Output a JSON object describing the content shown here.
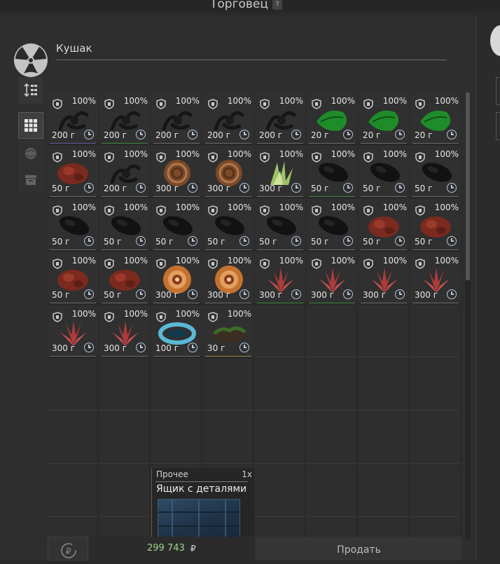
{
  "header": {
    "title": "Торговец",
    "help_label": "?"
  },
  "trader": {
    "name": "Кушак",
    "logo_icon": "radiation-icon"
  },
  "side_buttons": [
    {
      "icon": "sort-icon",
      "active": false
    },
    {
      "icon": "grid-view-icon",
      "active": true
    },
    {
      "icon": "artifact-filter-icon",
      "active": false
    },
    {
      "icon": "box-filter-icon",
      "active": false
    }
  ],
  "inventory": {
    "items": [
      {
        "pct": "100%",
        "weight": "200 г",
        "kind": "black-twig",
        "accent": "purple"
      },
      {
        "pct": "100%",
        "weight": "200 г",
        "kind": "black-twig",
        "accent": "green"
      },
      {
        "pct": "100%",
        "weight": "200 г",
        "kind": "black-twig",
        "accent": "none"
      },
      {
        "pct": "100%",
        "weight": "200 г",
        "kind": "black-twig",
        "accent": "none"
      },
      {
        "pct": "100%",
        "weight": "200 г",
        "kind": "black-twig",
        "accent": "none"
      },
      {
        "pct": "100%",
        "weight": "20 г",
        "kind": "green-leaf",
        "accent": "none"
      },
      {
        "pct": "100%",
        "weight": "20 г",
        "kind": "green-leaf",
        "accent": "none"
      },
      {
        "pct": "100%",
        "weight": "20 г",
        "kind": "green-leaf",
        "accent": "none"
      },
      {
        "pct": "100%",
        "weight": "50 г",
        "kind": "red-lump",
        "accent": "none"
      },
      {
        "pct": "100%",
        "weight": "200 г",
        "kind": "black-twig",
        "accent": "none"
      },
      {
        "pct": "100%",
        "weight": "300 г",
        "kind": "brown-coil",
        "accent": "none"
      },
      {
        "pct": "100%",
        "weight": "300 г",
        "kind": "brown-coil",
        "accent": "none"
      },
      {
        "pct": "100%",
        "weight": "300 г",
        "kind": "green-sprout",
        "accent": "none"
      },
      {
        "pct": "100%",
        "weight": "50 г",
        "kind": "black-pod",
        "accent": "green"
      },
      {
        "pct": "100%",
        "weight": "50 г",
        "kind": "black-pod",
        "accent": "none"
      },
      {
        "pct": "100%",
        "weight": "50 г",
        "kind": "black-pod",
        "accent": "none"
      },
      {
        "pct": "100%",
        "weight": "50 г",
        "kind": "black-pod",
        "accent": "none"
      },
      {
        "pct": "100%",
        "weight": "50 г",
        "kind": "black-pod",
        "accent": "none"
      },
      {
        "pct": "100%",
        "weight": "50 г",
        "kind": "black-pod",
        "accent": "none"
      },
      {
        "pct": "100%",
        "weight": "50 г",
        "kind": "black-pod",
        "accent": "none"
      },
      {
        "pct": "100%",
        "weight": "50 г",
        "kind": "black-pod",
        "accent": "none"
      },
      {
        "pct": "100%",
        "weight": "50 г",
        "kind": "black-pod",
        "accent": "none"
      },
      {
        "pct": "100%",
        "weight": "50 г",
        "kind": "red-lump",
        "accent": "none"
      },
      {
        "pct": "100%",
        "weight": "50 г",
        "kind": "red-lump",
        "accent": "none"
      },
      {
        "pct": "100%",
        "weight": "50 г",
        "kind": "red-lump",
        "accent": "none"
      },
      {
        "pct": "100%",
        "weight": "50 г",
        "kind": "red-lump",
        "accent": "none"
      },
      {
        "pct": "100%",
        "weight": "300 г",
        "kind": "orange-swirl",
        "accent": "none"
      },
      {
        "pct": "100%",
        "weight": "300 г",
        "kind": "orange-swirl",
        "accent": "none"
      },
      {
        "pct": "100%",
        "weight": "300 г",
        "kind": "red-coral",
        "accent": "green"
      },
      {
        "pct": "100%",
        "weight": "300 г",
        "kind": "red-coral",
        "accent": "green"
      },
      {
        "pct": "100%",
        "weight": "300 г",
        "kind": "red-coral",
        "accent": "none"
      },
      {
        "pct": "100%",
        "weight": "300 г",
        "kind": "red-coral",
        "accent": "none"
      },
      {
        "pct": "100%",
        "weight": "300 г",
        "kind": "red-coral",
        "accent": "none"
      },
      {
        "pct": "100%",
        "weight": "300 г",
        "kind": "red-coral",
        "accent": "none"
      },
      {
        "pct": "100%",
        "weight": "100 г",
        "kind": "blue-ring",
        "accent": "none"
      },
      {
        "pct": "100%",
        "weight": "30 г",
        "kind": "moss-rock",
        "accent": "gold"
      }
    ]
  },
  "tooltip": {
    "category": "Прочее",
    "quantity": "1x",
    "item_name": "Ящик с деталями",
    "image": "parts-crate"
  },
  "footer": {
    "balance": "299 743",
    "currency": "₽",
    "sell_label": "Продать",
    "refresh_icon": "ruble-refresh-icon"
  }
}
